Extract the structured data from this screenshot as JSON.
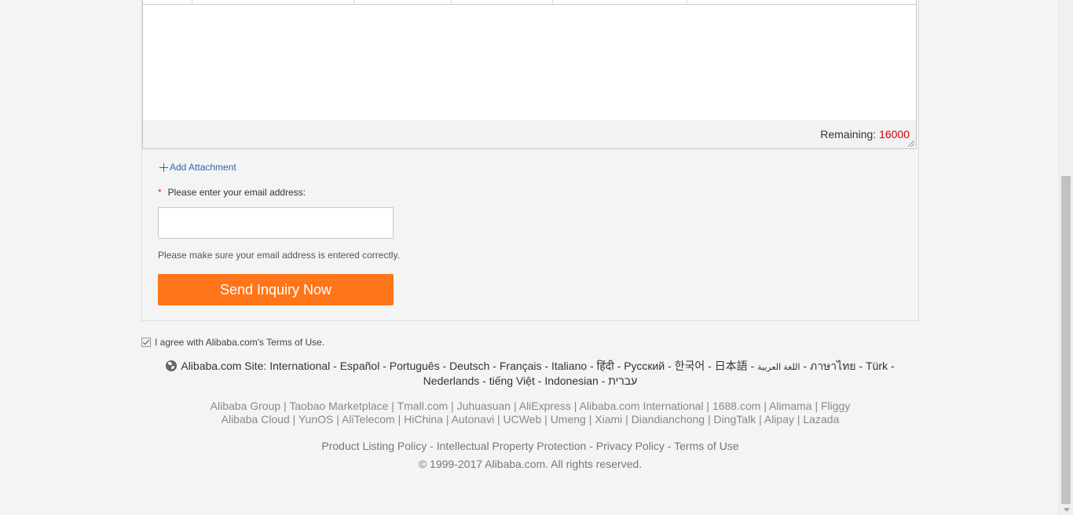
{
  "editor": {
    "remaining_label": "Remaining:",
    "remaining_count": "16000"
  },
  "form": {
    "add_attachment_label": "Add Attachment",
    "email_required_mark": "*",
    "email_label": "Please enter your email address:",
    "email_value": "",
    "email_hint": "Please make sure your email address is entered correctly.",
    "send_button_label": "Send Inquiry Now"
  },
  "agreement": {
    "checked": true,
    "text": "I agree with Alibaba.com's Terms of Use."
  },
  "footer": {
    "site_label": "Alibaba.com Site:",
    "languages": [
      "International",
      "Español",
      "Português",
      "Deutsch",
      "Français",
      "Italiano",
      "हिंदी",
      "Pусский",
      "한국어",
      "日本語",
      "اللغة العربية",
      "ภาษาไทย",
      "Türk",
      "Nederlands",
      "tiếng Việt",
      "Indonesian",
      "עברית"
    ],
    "group_row1": [
      "Alibaba Group",
      "Taobao Marketplace",
      "Tmall.com",
      "Juhuasuan",
      "AliExpress",
      "Alibaba.com International",
      "1688.com",
      "Alimama",
      "Fliggy"
    ],
    "group_row2": [
      "Alibaba Cloud",
      "YunOS",
      "AliTelecom",
      "HiChina",
      "Autonavi",
      "UCWeb",
      "Umeng",
      "Xiami",
      "Diandianchong",
      "DingTalk",
      "Alipay",
      "Lazada"
    ],
    "policies": [
      "Product Listing Policy",
      "Intellectual Property Protection",
      "Privacy Policy",
      "Terms of Use"
    ],
    "copyright": "© 1999-2017 Alibaba.com. All rights reserved."
  },
  "colors": {
    "accent_button": "#ff7519",
    "link_blue": "#3366aa",
    "remaining_count": "#cc0000",
    "background": "#f4f4f4"
  }
}
